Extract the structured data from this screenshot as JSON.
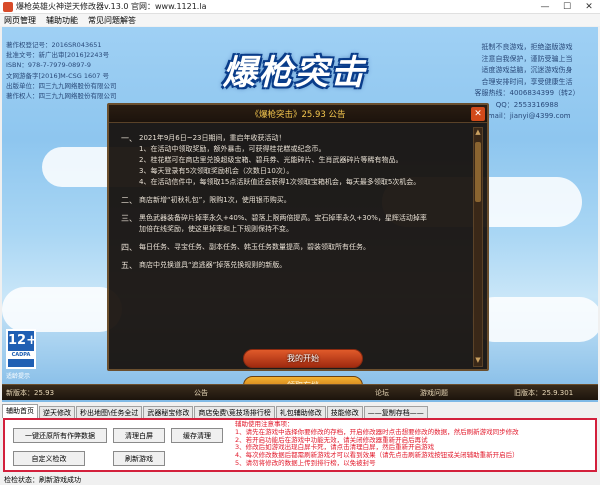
{
  "window": {
    "title": "爆枪英雄火神逆天修改器v.13.0 官网：www.1121.la",
    "min": "—",
    "max": "☐",
    "close": "✕"
  },
  "menu": [
    "网页管理",
    "辅助功能",
    "常见问题解答"
  ],
  "game": {
    "logo": "爆枪突击",
    "left_info": [
      "著作权登记号：2016SR043651",
      "批准文号：新广出审[2016]2243号",
      "ISBN：978-7-7979-0897-9",
      "文网游备字[2016]M-CSG 1607 号",
      "出版单位：四三九九网络股份有限公司",
      "著作权人：四三九九网络股份有限公司"
    ],
    "right_info": [
      "抵制不良游戏，拒绝盗版游戏",
      "注意自我保护，谨防受骗上当",
      "适度游戏益脑，沉迷游戏伤身",
      "合理安排时间，享受健康生活",
      "客服热线：4006834399（转2）",
      "QQ：2553316988",
      "Email：jianyi@4399.com"
    ],
    "notice": {
      "title": "《爆枪突击》25.93 公告",
      "sections": [
        {
          "num": "一、",
          "lines": [
            "2021年9月6日~23日期间，重启年收获活动！",
            "1、在活动中领取奖励，额外暴击，可获得桂花糕或纪念币。",
            "2、桂花糕可在商店里兑换超级宝箱、碧兵券、光能碎片、生肖武器碎片等稀有物品。",
            "3、每天登录有5次领取奖励机会（次数日10次）。",
            "4、在活动信件中，每领取15点活跃值还会获得1次领取宝箱机会，每天最多领取5次机会。"
          ]
        },
        {
          "num": "二、",
          "lines": [
            "商店新增“初秋礼包”，限购1次，使用银币购买。"
          ]
        },
        {
          "num": "三、",
          "lines": [
            "黑色武器装备碎片掉率永久+40%、碧落上限两倍提高。宝石掉率永久+30%，星辉活动掉率",
            "加倍在线奖励，使这里掉率和上下规则保持不变。"
          ]
        },
        {
          "num": "四、",
          "lines": [
            "每日任务、寻宝任务、副本任务、韩玉任务数量提高，碧装领取所有任务。"
          ]
        },
        {
          "num": "五、",
          "lines": [
            "商店中兑换道具“追逃器”掉落兑换规则的新版。"
          ]
        }
      ]
    },
    "age_rating": {
      "number": "12+",
      "label": "CADPA",
      "caption": "适龄提示"
    },
    "start_button": "我的开始",
    "enter_button": "领取存档",
    "bottom_left": "新版本：25.93",
    "bottom_nav": [
      "公告",
      "论坛",
      "游戏问题"
    ],
    "bottom_right": "旧版本：25.9.301"
  },
  "tabs": [
    "辅助首页",
    "逆天修改",
    "秒出地图\\任务全过",
    "武器秘宝修改",
    "商店免费\\竞技场排行榜",
    "礼包辅助修改",
    "技能修改",
    "——复制存档——"
  ],
  "panel": {
    "buttons": {
      "restore": "一键还原所有作弊数据",
      "clear_cache": "清理白屏",
      "cache_clean": "缓存清理",
      "custom": "自定义检改",
      "refresh": "刷新游戏"
    },
    "notes": [
      "辅助使用注意事项：",
      "1、请先在游戏中选择你要修改的存档，开启修改器时点击想要修改的数据，然后刷新游戏同步修改",
      "2、若开启功能后在游戏中功能无效，请关闭修改器重新开启后再试",
      "3、修改后如游戏出现白屏卡死，请点击清理白屏，然后重新开启游戏",
      "4、每次修改数据后都需刷新游戏才可以看到效果（请先点击刷新游戏按钮或关闭辅助重新开启后）",
      "5、请勿将修改的数据上传到排行榜，以免被封号"
    ]
  },
  "status": "检检状态：刷新游戏成功"
}
